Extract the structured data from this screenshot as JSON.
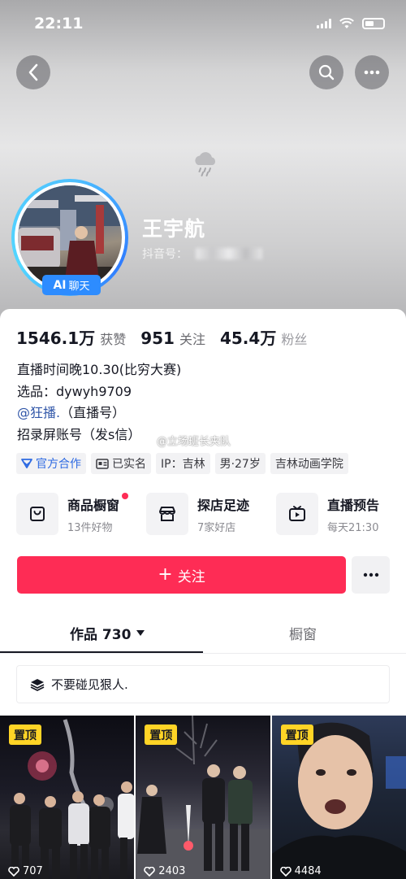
{
  "status_bar": {
    "time": "22:11"
  },
  "profile": {
    "username": "王宇航",
    "douyin_id_label": "抖音号：",
    "ai_badge": {
      "ai": "AI",
      "chat": "聊天"
    }
  },
  "stats": [
    {
      "value": "1546.1万",
      "label": "获赞"
    },
    {
      "value": "951",
      "label": "关注"
    },
    {
      "value": "45.4万",
      "label": "粉丝"
    }
  ],
  "bio": {
    "line1": "直播时间晚10.30(比穷大赛)",
    "line2": "选品：dywyh9709",
    "line3_mention": "@狂播.",
    "line3_suffix": "（直播号）",
    "line4": "招录屏账号（发s信）"
  },
  "watermark": "@立场班长夹队",
  "tags": [
    {
      "label": "官方合作",
      "icon": "official-icon"
    },
    {
      "label": "已实名",
      "icon": "id-card-icon"
    },
    {
      "label": "IP：吉林"
    },
    {
      "label": "男·27岁"
    },
    {
      "label": "吉林动画学院"
    }
  ],
  "features": [
    {
      "title": "商品橱窗",
      "subtitle": "13件好物",
      "icon": "shop-bag-icon",
      "has_dot": true
    },
    {
      "title": "探店足迹",
      "subtitle": "7家好店",
      "icon": "store-icon",
      "has_dot": false
    },
    {
      "title": "直播预告",
      "subtitle": "每天21:30",
      "icon": "live-tv-icon",
      "has_dot": false
    }
  ],
  "actions": {
    "follow_plus": "+",
    "follow_label": "关注"
  },
  "tabs": {
    "works_label": "作品 730",
    "shop_label": "橱窗"
  },
  "collection": {
    "label": "不要碰见狠人."
  },
  "videos": [
    {
      "pin_label": "置顶",
      "play_count": "707"
    },
    {
      "pin_label": "置顶",
      "play_count": "2403"
    },
    {
      "pin_label": "置顶",
      "play_count": "4484"
    }
  ],
  "colors": {
    "accent": "#fe2c55",
    "mention": "#3056a8",
    "ai_badge": "#2d8cff",
    "pin": "#ffd426"
  }
}
